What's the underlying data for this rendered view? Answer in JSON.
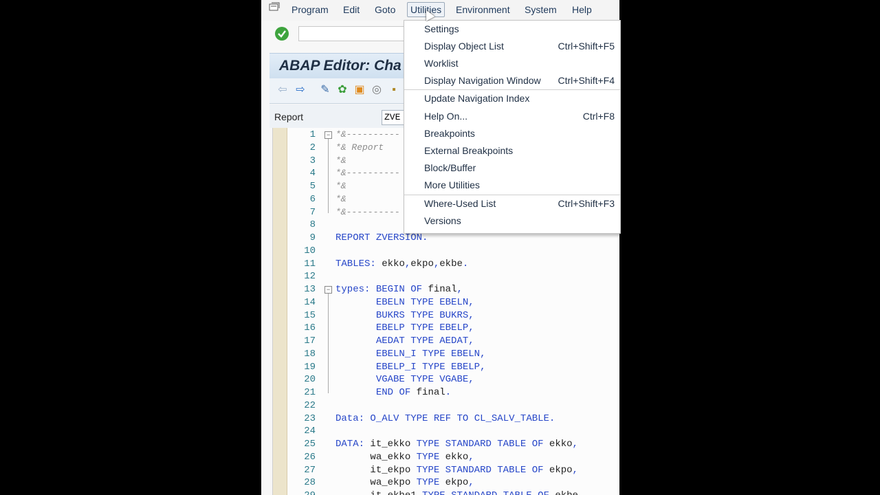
{
  "menubar": {
    "items": [
      {
        "label": "Program"
      },
      {
        "label": "Edit"
      },
      {
        "label": "Goto"
      },
      {
        "label": "Utilities"
      },
      {
        "label": "Environment"
      },
      {
        "label": "System"
      },
      {
        "label": "Help"
      }
    ],
    "active_item": "Utilities"
  },
  "title": {
    "text": "ABAP Editor: Cha"
  },
  "report": {
    "label": "Report",
    "value": "ZVE"
  },
  "dropdown": {
    "items": [
      {
        "label": "Settings",
        "shortcut": ""
      },
      {
        "label": "Display Object List",
        "shortcut": "Ctrl+Shift+F5"
      },
      {
        "label": "Worklist",
        "shortcut": ""
      },
      {
        "label": "Display Navigation Window",
        "shortcut": "Ctrl+Shift+F4"
      },
      {
        "label": "Update Navigation Index",
        "shortcut": ""
      },
      {
        "label": "Help On...",
        "shortcut": "Ctrl+F8"
      },
      {
        "label": "Breakpoints",
        "shortcut": ""
      },
      {
        "label": "External Breakpoints",
        "shortcut": ""
      },
      {
        "label": "Block/Buffer",
        "shortcut": ""
      },
      {
        "label": "More Utilities",
        "shortcut": ""
      },
      {
        "label": "Where-Used List",
        "shortcut": "Ctrl+Shift+F3"
      },
      {
        "label": "Versions",
        "shortcut": ""
      }
    ]
  },
  "editor": {
    "lines": [
      {
        "n": "1",
        "text": "*&----------"
      },
      {
        "n": "2",
        "text": "*& Report"
      },
      {
        "n": "3",
        "text": "*&"
      },
      {
        "n": "4",
        "text": "*&----------"
      },
      {
        "n": "5",
        "text": "*&"
      },
      {
        "n": "6",
        "text": "*&"
      },
      {
        "n": "7",
        "text": "*&----------"
      },
      {
        "n": "8",
        "text": ""
      },
      {
        "n": "9",
        "text": "REPORT ZVERSION."
      },
      {
        "n": "10",
        "text": ""
      },
      {
        "n": "11",
        "text": "TABLES: ekko,ekpo,ekbe."
      },
      {
        "n": "12",
        "text": ""
      },
      {
        "n": "13",
        "text": "types: BEGIN OF final,"
      },
      {
        "n": "14",
        "text": "       EBELN TYPE EBELN,"
      },
      {
        "n": "15",
        "text": "       BUKRS TYPE BUKRS,"
      },
      {
        "n": "16",
        "text": "       EBELP TYPE EBELP,"
      },
      {
        "n": "17",
        "text": "       AEDAT TYPE AEDAT,"
      },
      {
        "n": "18",
        "text": "       EBELN_I TYPE EBELN,"
      },
      {
        "n": "19",
        "text": "       EBELP_I TYPE EBELP,"
      },
      {
        "n": "20",
        "text": "       VGABE TYPE VGABE,"
      },
      {
        "n": "21",
        "text": "       END OF final."
      },
      {
        "n": "22",
        "text": ""
      },
      {
        "n": "23",
        "text": "Data: O_ALV TYPE REF TO CL_SALV_TABLE."
      },
      {
        "n": "24",
        "text": ""
      },
      {
        "n": "25",
        "text": "DATA: it_ekko TYPE STANDARD TABLE OF ekko,"
      },
      {
        "n": "26",
        "text": "      wa_ekko TYPE ekko,"
      },
      {
        "n": "27",
        "text": "      it_ekpo TYPE STANDARD TABLE OF ekpo,"
      },
      {
        "n": "28",
        "text": "      wa_ekpo TYPE ekpo,"
      },
      {
        "n": "29",
        "text": "      it_ekbe1 TYPE STANDARD TABLE OF ekbe"
      }
    ]
  }
}
